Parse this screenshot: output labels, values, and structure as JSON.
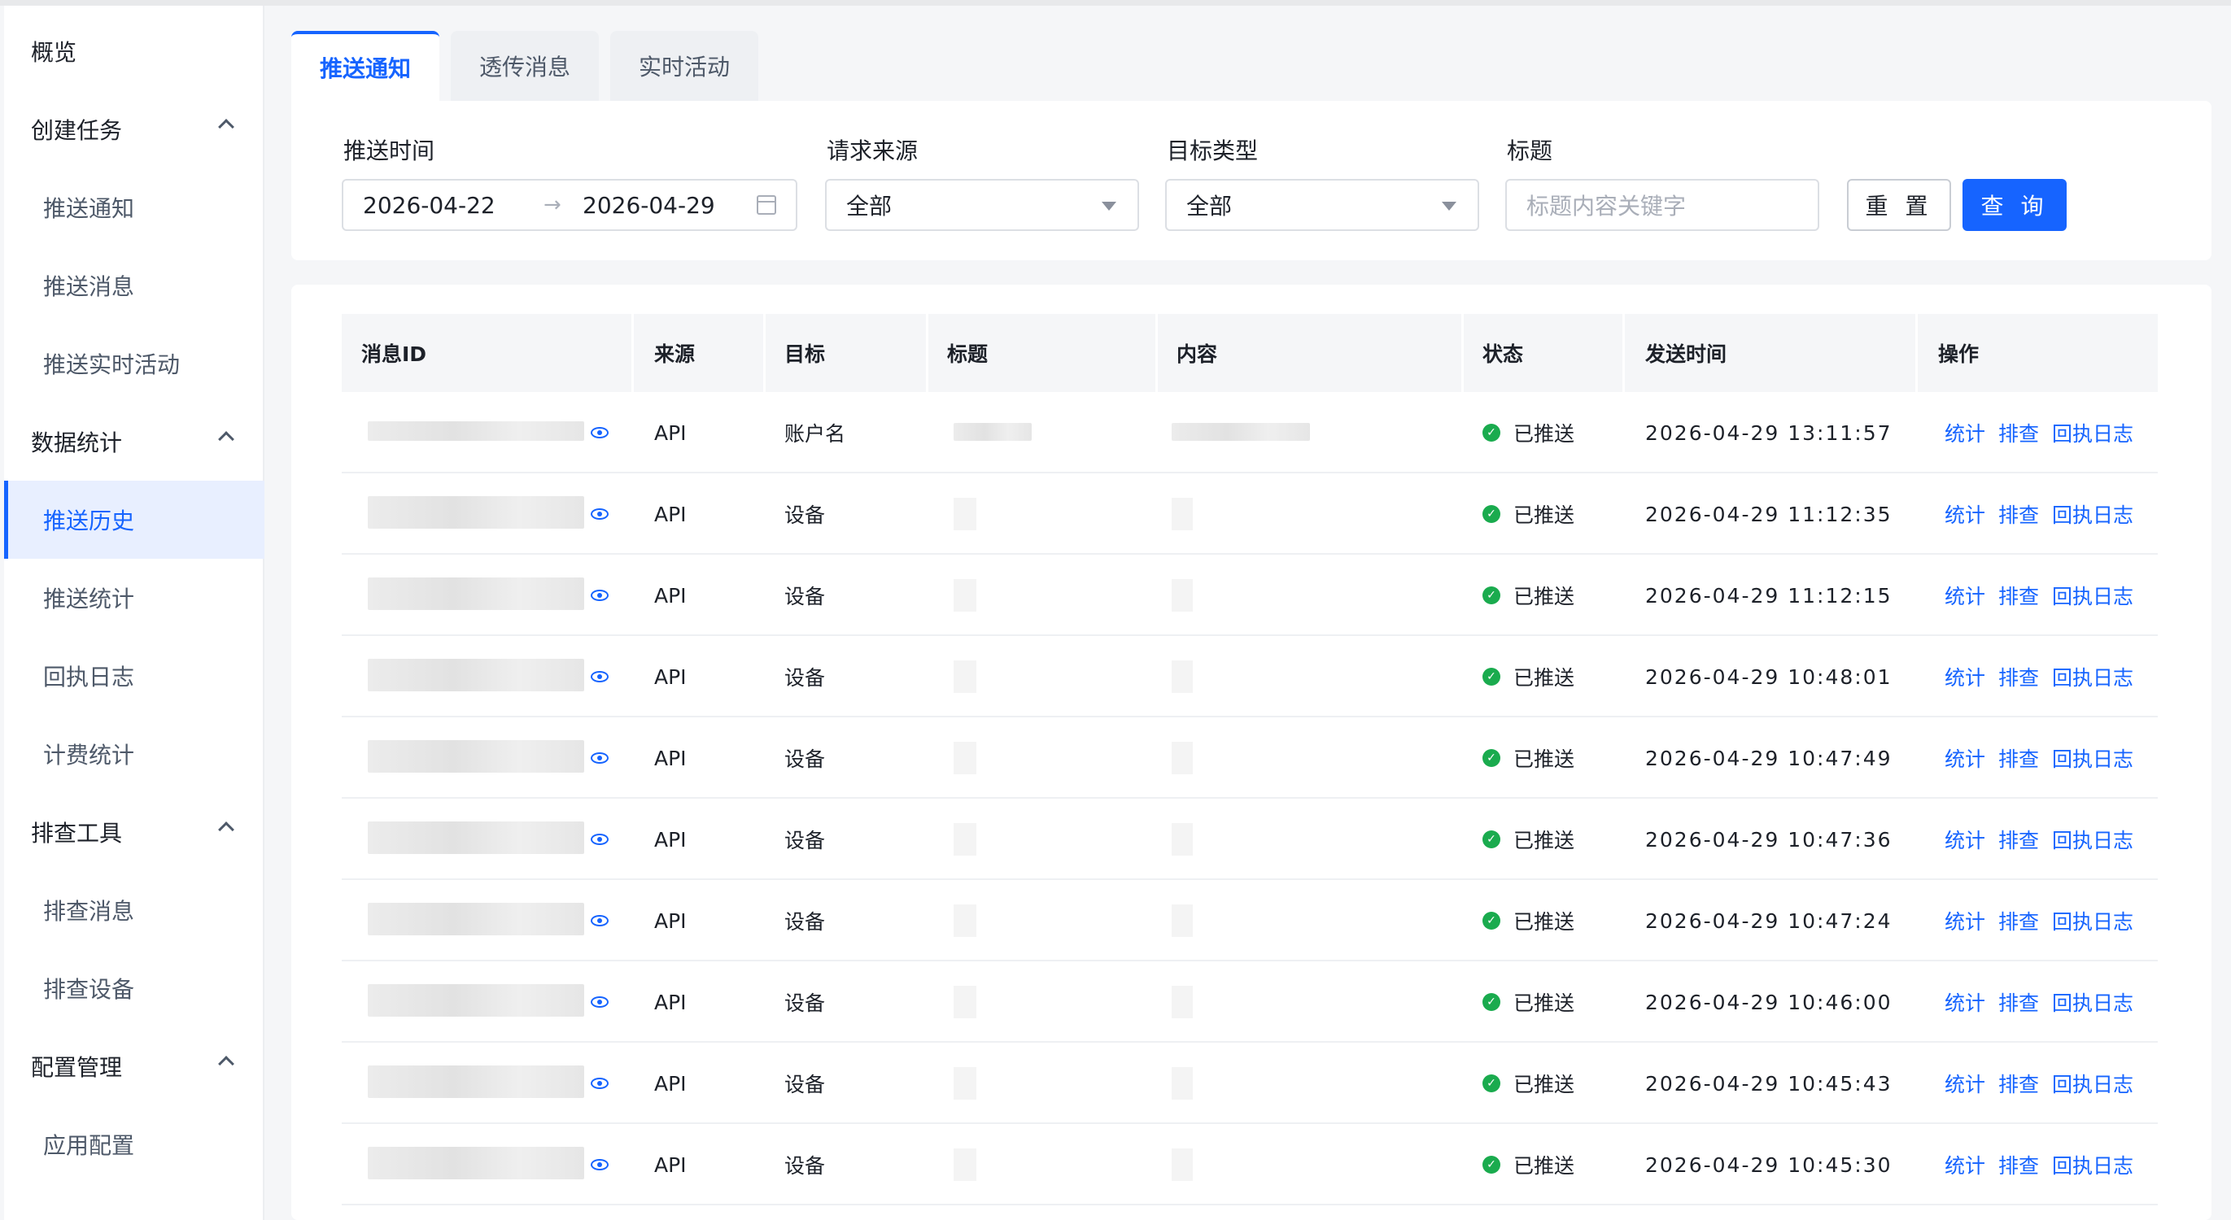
{
  "sidebar": {
    "items": [
      {
        "label": "概览",
        "type": "group",
        "expandable": false
      },
      {
        "label": "创建任务",
        "type": "group",
        "expandable": true
      },
      {
        "label": "推送通知",
        "type": "child"
      },
      {
        "label": "推送消息",
        "type": "child"
      },
      {
        "label": "推送实时活动",
        "type": "child"
      },
      {
        "label": "数据统计",
        "type": "group",
        "expandable": true
      },
      {
        "label": "推送历史",
        "type": "child",
        "active": true
      },
      {
        "label": "推送统计",
        "type": "child"
      },
      {
        "label": "回执日志",
        "type": "child"
      },
      {
        "label": "计费统计",
        "type": "child"
      },
      {
        "label": "排查工具",
        "type": "group",
        "expandable": true
      },
      {
        "label": "排查消息",
        "type": "child"
      },
      {
        "label": "排查设备",
        "type": "child"
      },
      {
        "label": "配置管理",
        "type": "group",
        "expandable": true
      },
      {
        "label": "应用配置",
        "type": "child"
      }
    ]
  },
  "tabs": [
    {
      "label": "推送通知",
      "active": true
    },
    {
      "label": "透传消息",
      "active": false
    },
    {
      "label": "实时活动",
      "active": false
    }
  ],
  "filters": {
    "push_time_label": "推送时间",
    "date_start": "2026-04-22",
    "date_separator": "→",
    "date_end": "2026-04-29",
    "source_label": "请求来源",
    "source_value": "全部",
    "target_type_label": "目标类型",
    "target_type_value": "全部",
    "title_label": "标题",
    "title_placeholder": "标题内容关键字",
    "reset_label": "重 置",
    "query_label": "查 询"
  },
  "table": {
    "columns": [
      "消息ID",
      "来源",
      "目标",
      "标题",
      "内容",
      "状态",
      "发送时间",
      "操作"
    ],
    "actions": [
      "统计",
      "排查",
      "回执日志"
    ],
    "rows": [
      {
        "source": "API",
        "target": "账户名",
        "status": "已推送",
        "time": "2026-04-29 13:11:57"
      },
      {
        "source": "API",
        "target": "设备",
        "status": "已推送",
        "time": "2026-04-29 11:12:35"
      },
      {
        "source": "API",
        "target": "设备",
        "status": "已推送",
        "time": "2026-04-29 11:12:15"
      },
      {
        "source": "API",
        "target": "设备",
        "status": "已推送",
        "time": "2026-04-29 10:48:01"
      },
      {
        "source": "API",
        "target": "设备",
        "status": "已推送",
        "time": "2026-04-29 10:47:49"
      },
      {
        "source": "API",
        "target": "设备",
        "status": "已推送",
        "time": "2026-04-29 10:47:36"
      },
      {
        "source": "API",
        "target": "设备",
        "status": "已推送",
        "time": "2026-04-29 10:47:24"
      },
      {
        "source": "API",
        "target": "设备",
        "status": "已推送",
        "time": "2026-04-29 10:46:00"
      },
      {
        "source": "API",
        "target": "设备",
        "status": "已推送",
        "time": "2026-04-29 10:45:43"
      },
      {
        "source": "API",
        "target": "设备",
        "status": "已推送",
        "time": "2026-04-29 10:45:30"
      }
    ]
  },
  "colors": {
    "accent": "#1664ff",
    "success": "#1aab4e",
    "active_bg": "#e8efff"
  },
  "icons": {
    "status": "check-circle-icon",
    "view": "eye-icon",
    "expand": "chevron-up-icon",
    "calendar": "calendar-icon",
    "dropdown": "caret-down-icon"
  }
}
